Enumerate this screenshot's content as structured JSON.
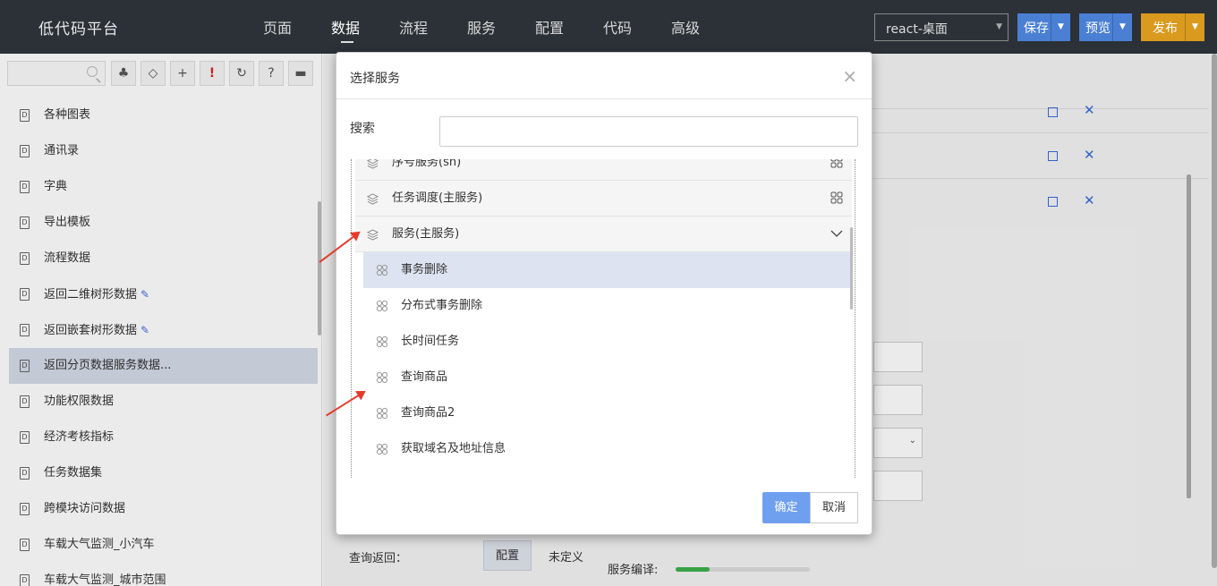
{
  "app": {
    "title": "低代码平台"
  },
  "nav": {
    "items": [
      "页面",
      "数据",
      "流程",
      "服务",
      "配置",
      "代码",
      "高级"
    ],
    "active": "数据"
  },
  "toolbar": {
    "app_select": "react-桌面",
    "save": "保存",
    "preview": "预览",
    "publish": "发布"
  },
  "sidebar": {
    "search_placeholder": "",
    "items": [
      {
        "label": "各种图表"
      },
      {
        "label": "通讯录"
      },
      {
        "label": "字典"
      },
      {
        "label": "导出模板"
      },
      {
        "label": "流程数据"
      },
      {
        "label": "返回二维树形数据",
        "pen": "✎"
      },
      {
        "label": "返回嵌套树形数据",
        "pen": "✎"
      },
      {
        "label": "返回分页数据服务数据...",
        "selected": true
      },
      {
        "label": "功能权限数据"
      },
      {
        "label": "经济考核指标"
      },
      {
        "label": "任务数据集"
      },
      {
        "label": "跨模块访问数据"
      },
      {
        "label": "车载大气监测_小汽车"
      },
      {
        "label": "车载大气监测_城市范围"
      }
    ]
  },
  "main": {
    "query_return_label": "查询返回：",
    "config_tab": "配置",
    "undefined_label": "未定义",
    "service_compile_label": "服务编译:",
    "compile_progress": 0.25
  },
  "modal": {
    "title": "选择服务",
    "close": "×",
    "search_label": "搜索",
    "search_value": "",
    "groups": [
      {
        "label": "序号服务(sn)"
      },
      {
        "label": "任务调度(主服务)"
      },
      {
        "label": "服务(主服务)",
        "expanded": true
      }
    ],
    "services": [
      {
        "label": "事务删除",
        "selected": true
      },
      {
        "label": "分布式事务删除"
      },
      {
        "label": "长时间任务"
      },
      {
        "label": "查询商品"
      },
      {
        "label": "查询商品2"
      },
      {
        "label": "获取域名及地址信息"
      }
    ],
    "ok": "确定",
    "cancel": "取消"
  },
  "colors": {
    "topbar": "#2b3137",
    "save": "#4a7fd4",
    "preview": "#4a7fd4",
    "publish": "#d99a1e",
    "ok": "#6fa0f0",
    "arrow": "#e43b2c"
  }
}
